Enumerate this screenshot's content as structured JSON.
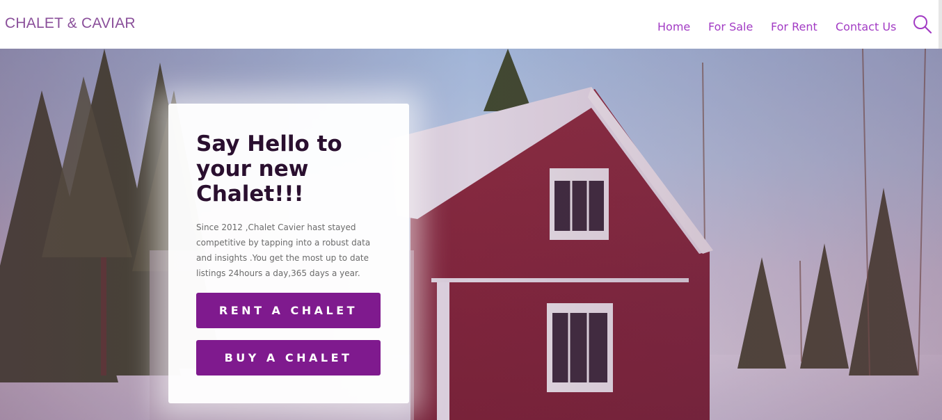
{
  "header": {
    "logo": "CHALET & CAVIAR",
    "nav": [
      {
        "label": "Home"
      },
      {
        "label": "For Sale"
      },
      {
        "label": "For Rent"
      },
      {
        "label": "Contact Us"
      }
    ],
    "search_icon": "search-icon"
  },
  "hero": {
    "title": "Say Hello to your new Chalet!!!",
    "description": "Since 2012 ,Chalet Cavier hast stayed competitive by tapping into a robust data and insights .You get the most up to date listings 24hours a day,365 days a year.",
    "rent_button": "RENT A CHALET",
    "buy_button": "BUY A CHALET"
  },
  "colors": {
    "accent": "#a23bc4",
    "button": "#7f1a8e",
    "logo": "#8a4f9a",
    "title": "#2a0f2f"
  }
}
